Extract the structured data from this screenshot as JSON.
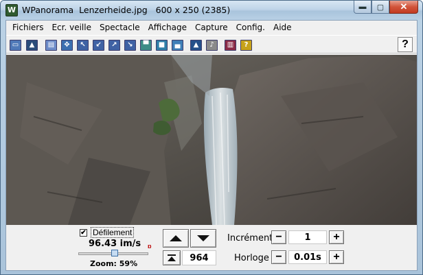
{
  "window": {
    "title": "WPanorama  Lenzerheide.jpg   600 x 250 (2385)",
    "app_icon_glyph": "W",
    "minimize_glyph": "▬",
    "maximize_glyph": "▢",
    "close_glyph": "✕"
  },
  "menu": {
    "items": [
      "Fichiers",
      "Ecr. veille",
      "Spectacle",
      "Affichage",
      "Capture",
      "Config.",
      "Aide"
    ]
  },
  "toolbar": {
    "buttons": [
      {
        "icon": "open-file-icon",
        "glyph": "▭",
        "bg": "#4f79b8"
      },
      {
        "icon": "image-icon",
        "glyph": "▲",
        "bg": "#2a4c7a"
      },
      {
        "icon": "document-icon",
        "glyph": "▤",
        "bg": "#6d8cc9"
      },
      {
        "icon": "move-icon",
        "glyph": "✥",
        "bg": "#3c6fb0"
      },
      {
        "icon": "arrow-up-left-icon",
        "glyph": "↖",
        "bg": "#3f62a4"
      },
      {
        "icon": "arrow-down-left-icon",
        "glyph": "↙",
        "bg": "#3f62a4"
      },
      {
        "icon": "arrow-up-right-icon",
        "glyph": "↗",
        "bg": "#3f62a4"
      },
      {
        "icon": "arrow-down-right-icon",
        "glyph": "↘",
        "bg": "#3f62a4"
      },
      {
        "icon": "panorama-top-icon",
        "glyph": "▀",
        "bg": "#3e8d86"
      },
      {
        "icon": "panorama-middle-icon",
        "glyph": "■",
        "bg": "#2f7fa8"
      },
      {
        "icon": "panorama-bottom-icon",
        "glyph": "▄",
        "bg": "#3f7fb7"
      },
      {
        "icon": "align-center-icon",
        "glyph": "▲",
        "bg": "#24508a"
      },
      {
        "icon": "sound-icon",
        "glyph": "♪",
        "bg": "#8a8a8a"
      },
      {
        "icon": "book-icon",
        "glyph": "▥",
        "bg": "#8b2b47"
      },
      {
        "icon": "help-document-icon",
        "glyph": "?",
        "bg": "#c7a21a"
      }
    ],
    "help_label": "?"
  },
  "controls": {
    "scroll_checked": true,
    "check_mark": "✔",
    "scroll_label": "Défilement",
    "speed": "96.43 im/s",
    "dvd_icon": "ɒ",
    "zoom_label": "Zoom: 59%",
    "zoom_fraction": 0.52,
    "up_glyph": "▲",
    "down_glyph": "▼",
    "top_glyph": "⏶",
    "position": "964",
    "increment_label": "Incrément",
    "increment_value": "1",
    "clock_label": "Horloge",
    "clock_value": "0.01s",
    "minus_glyph": "−",
    "plus_glyph": "+"
  }
}
